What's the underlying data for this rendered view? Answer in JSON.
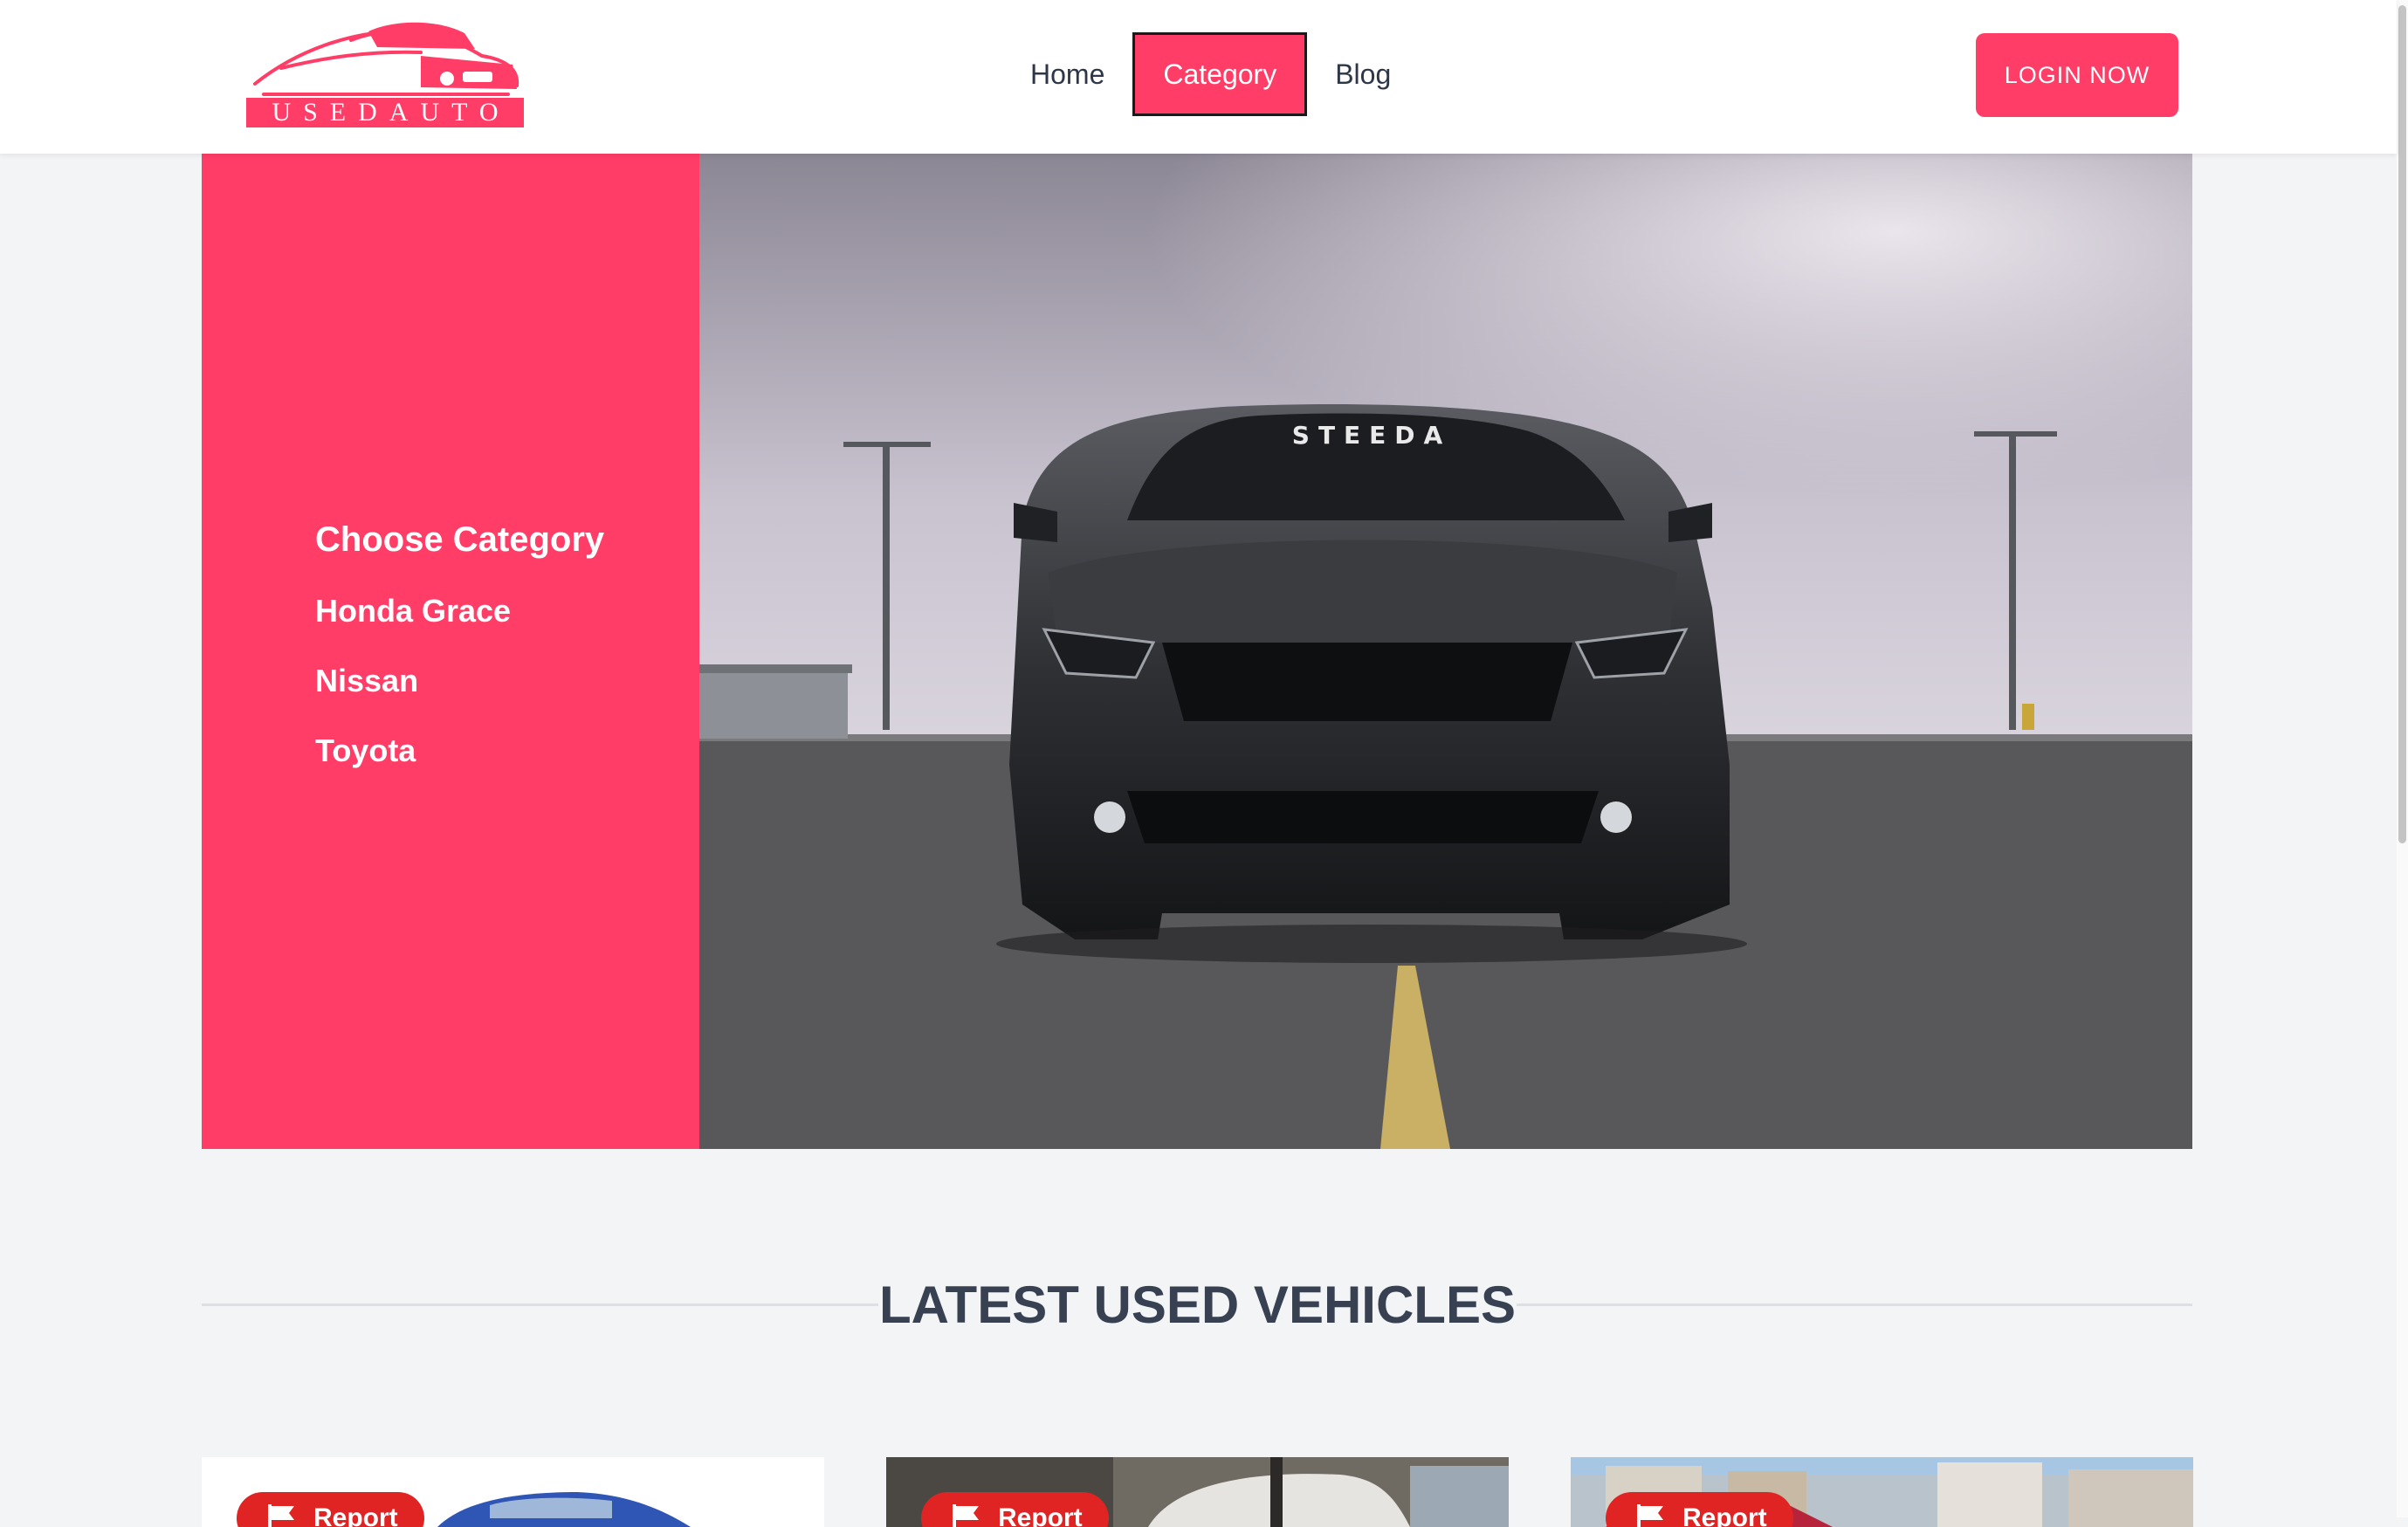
{
  "header": {
    "logo": {
      "text": "USEDAUTO",
      "icon": "car-logo-icon"
    },
    "nav": [
      {
        "label": "Home",
        "active": false
      },
      {
        "label": "Category",
        "active": true
      },
      {
        "label": "Blog",
        "active": false
      }
    ],
    "login_label": "LOGIN NOW"
  },
  "hero": {
    "category_title": "Choose Category",
    "categories": [
      "Honda Grace",
      "Nissan",
      "Toyota"
    ],
    "image_subject": "dark sports car on parking deck",
    "windshield_text": "STEEDA"
  },
  "section": {
    "title": "LATEST USED VEHICLES"
  },
  "cards": [
    {
      "report_label": "Report",
      "icon": "flag-icon"
    },
    {
      "report_label": "Report",
      "icon": "flag-icon"
    },
    {
      "report_label": "Report",
      "icon": "flag-icon"
    }
  ],
  "colors": {
    "accent": "#ff3d67",
    "report": "#e02424",
    "heading": "#374151",
    "background": "#f3f4f6"
  }
}
